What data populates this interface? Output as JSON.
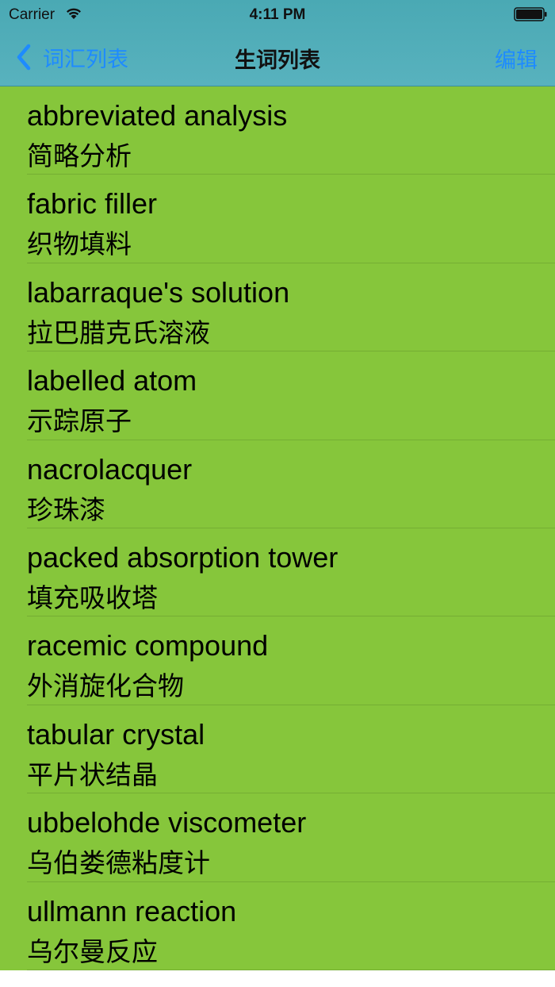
{
  "status_bar": {
    "carrier": "Carrier",
    "time": "4:11 PM"
  },
  "nav": {
    "back_label": "词汇列表",
    "title": "生词列表",
    "edit_label": "编辑"
  },
  "words": [
    {
      "term": "abbreviated analysis",
      "translation": "简略分析"
    },
    {
      "term": "fabric filler",
      "translation": "织物填料"
    },
    {
      "term": "labarraque's solution",
      "translation": "拉巴腊克氏溶液"
    },
    {
      "term": "labelled atom",
      "translation": "示踪原子"
    },
    {
      "term": "nacrolacquer",
      "translation": "珍珠漆"
    },
    {
      "term": "packed absorption tower",
      "translation": "填充吸收塔"
    },
    {
      "term": "racemic compound",
      "translation": "外消旋化合物"
    },
    {
      "term": "tabular crystal",
      "translation": "平片状结晶"
    },
    {
      "term": "ubbelohde viscometer",
      "translation": "乌伯娄德粘度计"
    },
    {
      "term": "ullmann reaction",
      "translation": "乌尔曼反应"
    }
  ],
  "colors": {
    "nav_background": "#4aa9b4",
    "list_background": "#86c63b",
    "accent": "#1e8bff"
  },
  "icons": {
    "back": "chevron-left-icon",
    "wifi": "wifi-icon",
    "battery": "battery-icon"
  }
}
